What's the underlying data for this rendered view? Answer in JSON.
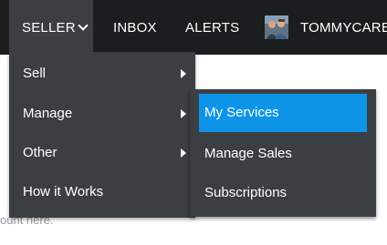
{
  "topnav": {
    "seller_label": "SELLER",
    "inbox_label": "INBOX",
    "alerts_label": "ALERTS",
    "username": "TOMMYCAREY"
  },
  "page": {
    "partial_text": "ount here."
  },
  "seller_menu": {
    "items": [
      {
        "label": "Sell",
        "has_submenu": true
      },
      {
        "label": "Manage",
        "has_submenu": true
      },
      {
        "label": "Other",
        "has_submenu": true
      },
      {
        "label": "How it Works",
        "has_submenu": false
      }
    ]
  },
  "manage_submenu": {
    "items": [
      {
        "label": "My Services",
        "highlighted": true
      },
      {
        "label": "Manage Sales",
        "highlighted": false
      },
      {
        "label": "Subscriptions",
        "highlighted": false
      }
    ]
  },
  "colors": {
    "topbar": "#1c1d1e",
    "menu_bg": "#3b3f44",
    "highlight": "#0d94e7"
  },
  "icons": {
    "seller_dropdown": "chevron-down-icon",
    "submenu_arrow": "caret-right-icon",
    "avatar": "user-avatar-photo"
  }
}
